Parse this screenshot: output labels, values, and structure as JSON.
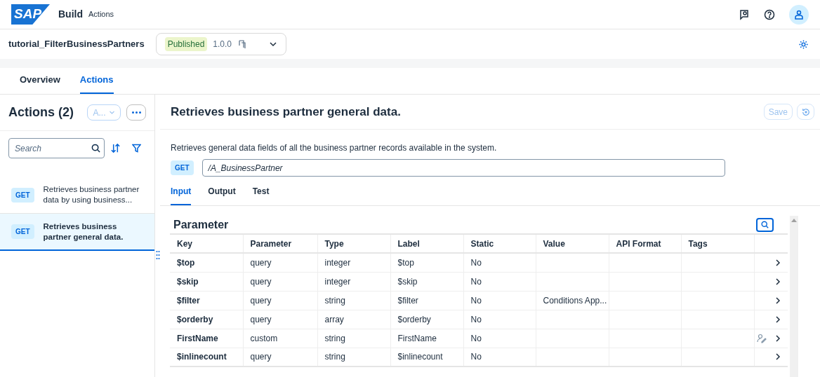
{
  "header": {
    "logo": "SAP",
    "product": "Build",
    "section": "Actions"
  },
  "project": {
    "name": "tutorial_FilterBusinessPartners",
    "status": "Published",
    "version": "1.0.0"
  },
  "tabs": [
    {
      "label": "Overview",
      "selected": false
    },
    {
      "label": "Actions",
      "selected": true
    }
  ],
  "sidebar": {
    "title": "Actions (2)",
    "filter_button": "A...",
    "search": {
      "placeholder": "Search"
    },
    "items": [
      {
        "method": "GET",
        "label": "Retrieves business partner data by using business...",
        "selected": false
      },
      {
        "method": "GET",
        "label": "Retrieves business partner general data.",
        "selected": true
      }
    ]
  },
  "detail": {
    "title": "Retrieves business partner general data.",
    "save": "Save",
    "save_disabled": true,
    "description": "Retrieves general data fields of all the business partner records available in the system.",
    "method": "GET",
    "path": "/A_BusinessPartner",
    "tabs": [
      {
        "label": "Input",
        "selected": true
      },
      {
        "label": "Output",
        "selected": false
      },
      {
        "label": "Test",
        "selected": false
      }
    ],
    "table": {
      "title": "Parameter",
      "columns": [
        "Key",
        "Parameter",
        "Type",
        "Label",
        "Static",
        "Value",
        "API Format",
        "Tags"
      ],
      "rows": [
        {
          "cells": [
            "$top",
            "query",
            "integer",
            "$top",
            "No",
            "",
            "",
            ""
          ],
          "edited": false
        },
        {
          "cells": [
            "$skip",
            "query",
            "integer",
            "$skip",
            "No",
            "",
            "",
            ""
          ],
          "edited": false
        },
        {
          "cells": [
            "$filter",
            "query",
            "string",
            "$filter",
            "No",
            "Conditions App...",
            "",
            ""
          ],
          "edited": false
        },
        {
          "cells": [
            "$orderby",
            "query",
            "array",
            "$orderby",
            "No",
            "",
            "",
            ""
          ],
          "edited": false
        },
        {
          "cells": [
            "FirstName",
            "custom",
            "string",
            "FirstName",
            "No",
            "",
            "",
            ""
          ],
          "edited": true
        },
        {
          "cells": [
            "$inlinecount",
            "query",
            "string",
            "$inlinecount",
            "No",
            "",
            "",
            ""
          ],
          "edited": false
        }
      ]
    }
  }
}
